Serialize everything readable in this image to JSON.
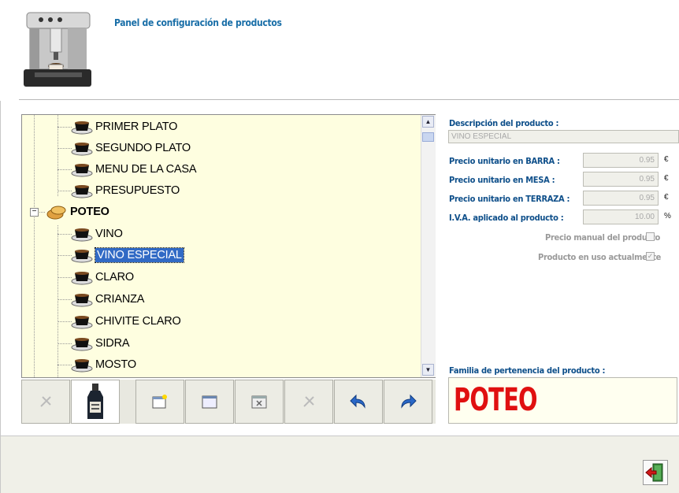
{
  "header": {
    "title": "Panel de configuración de productos"
  },
  "tree": {
    "items": [
      {
        "label": "PRIMER PLATO",
        "type": "product"
      },
      {
        "label": "SEGUNDO PLATO",
        "type": "product"
      },
      {
        "label": "MENU DE LA CASA",
        "type": "product"
      },
      {
        "label": "PRESUPUESTO",
        "type": "product"
      },
      {
        "label": "POTEO",
        "type": "group",
        "expanded": true
      },
      {
        "label": "VINO",
        "type": "product"
      },
      {
        "label": "VINO ESPECIAL",
        "type": "product",
        "selected": true
      },
      {
        "label": "CLARO",
        "type": "product"
      },
      {
        "label": "CRIANZA",
        "type": "product"
      },
      {
        "label": "CHIVITE CLARO",
        "type": "product"
      },
      {
        "label": "SIDRA",
        "type": "product"
      },
      {
        "label": "MOSTO",
        "type": "product"
      }
    ],
    "expander_symbol": "−",
    "scroll_up_symbol": "▲",
    "scroll_down_symbol": "▼"
  },
  "toolbar": {
    "buttons": [
      {
        "name": "disabled-tool-icon"
      },
      {
        "name": "bottle-image"
      },
      {
        "name": "new-product-icon"
      },
      {
        "name": "window-icon"
      },
      {
        "name": "delete-window-icon"
      },
      {
        "name": "disabled-tool-icon"
      },
      {
        "name": "undo-arrow-icon"
      },
      {
        "name": "redo-arrow-icon"
      }
    ]
  },
  "details": {
    "description_label": "Descripción del producto :",
    "description_value": "VINO ESPECIAL",
    "price_bar_label": "Precio unitario en BARRA :",
    "price_bar_value": "0.95",
    "price_table_label": "Precio unitario en MESA :",
    "price_table_value": "0.95",
    "price_terrace_label": "Precio unitario en TERRAZA :",
    "price_terrace_value": "0.95",
    "vat_label": "I.V.A. aplicado al producto :",
    "vat_value": "10.00",
    "currency_unit": "€",
    "percent_unit": "%",
    "manual_price_label": "Precio manual del producto",
    "manual_price_checked": false,
    "in_use_label": "Producto en uso actualmente",
    "in_use_checked": true,
    "check_mark": "✓",
    "family_label": "Familia de pertenencia del producto :",
    "family_value": "POTEO"
  },
  "colors": {
    "tree_background": "#fefee0",
    "selection": "#316ac5",
    "label_blue": "#0e4f8a",
    "family_red": "#e01010"
  }
}
